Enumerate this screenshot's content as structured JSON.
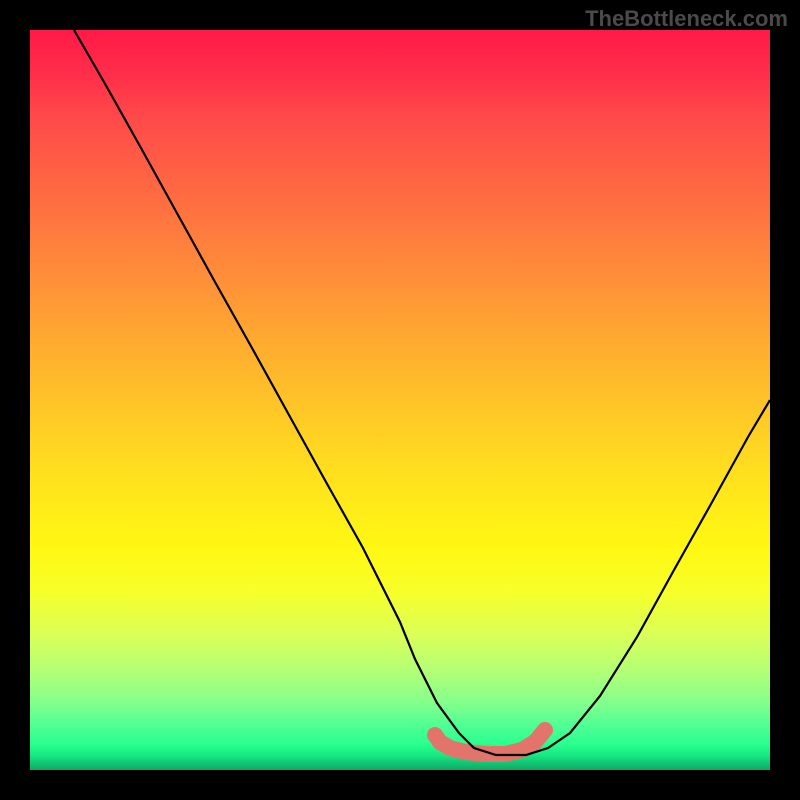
{
  "watermark": "TheBottleneck.com",
  "chart_data": {
    "type": "line",
    "title": "",
    "xlabel": "",
    "ylabel": "",
    "xlim": [
      0,
      100
    ],
    "ylim": [
      0,
      100
    ],
    "grid": false,
    "series": [
      {
        "name": "bottleneck-curve",
        "x": [
          6,
          10,
          15,
          20,
          25,
          30,
          35,
          40,
          45,
          50,
          52,
          55,
          58,
          60,
          63,
          67,
          70,
          73,
          77,
          82,
          87,
          92,
          97,
          100
        ],
        "y": [
          100,
          93,
          84,
          75,
          66,
          57,
          48,
          39,
          30,
          20,
          15,
          9,
          5,
          3,
          2,
          2,
          3,
          5,
          10,
          18,
          27,
          36,
          45,
          50
        ]
      }
    ],
    "annotations": [
      {
        "name": "optimal-band",
        "x_range": [
          55,
          72
        ],
        "y": 2,
        "color": "#e2746c"
      }
    ],
    "background_gradient": {
      "type": "vertical",
      "stops": [
        {
          "pos": 0,
          "color": "#ff1a47"
        },
        {
          "pos": 50,
          "color": "#ffd024"
        },
        {
          "pos": 75,
          "color": "#f7ff2a"
        },
        {
          "pos": 100,
          "color": "#0fa866"
        }
      ]
    }
  }
}
